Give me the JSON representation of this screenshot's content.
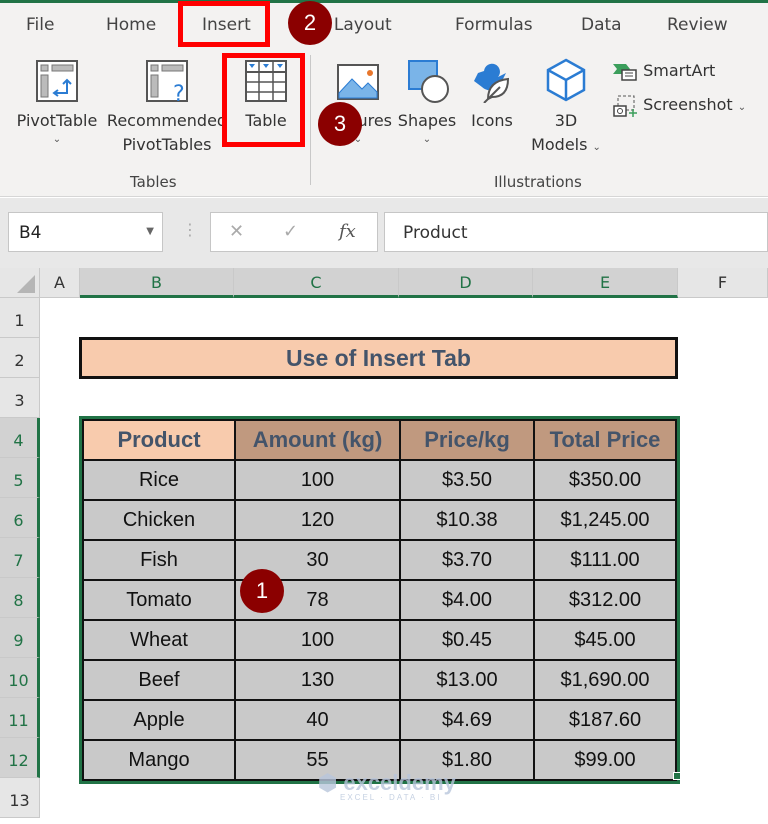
{
  "menu": {
    "tabs": [
      "File",
      "Home",
      "Insert",
      "Page Layout",
      "Formulas",
      "Data",
      "Review"
    ],
    "visible_page_layout": "e Layout"
  },
  "ribbon": {
    "tables_group": {
      "label": "Tables",
      "pivottable": "PivotTable",
      "recommended_line1": "Recommended",
      "recommended_line2": "PivotTables",
      "table": "Table"
    },
    "illustrations_group": {
      "label": "Illustrations",
      "pictures": "ures",
      "shapes": "Shapes",
      "icons": "Icons",
      "models_line1": "3D",
      "models_line2": "Models",
      "smartart": "SmartArt",
      "screenshot": "Screenshot"
    }
  },
  "annotations": {
    "badge1": "1",
    "badge2": "2",
    "badge3": "3"
  },
  "formula_bar": {
    "name_box": "B4",
    "formula": "Product",
    "cancel_icon": "✕",
    "enter_icon": "✓",
    "fx_icon": "fx"
  },
  "grid": {
    "columns": [
      "A",
      "B",
      "C",
      "D",
      "E",
      "F"
    ],
    "rows": [
      "1",
      "2",
      "3",
      "4",
      "5",
      "6",
      "7",
      "8",
      "9",
      "10",
      "11",
      "12",
      "13"
    ]
  },
  "sheet": {
    "title": "Use of Insert Tab",
    "headers": [
      "Product",
      "Amount (kg)",
      "Price/kg",
      "Total Price"
    ],
    "rows": [
      [
        "Rice",
        "100",
        "$3.50",
        "$350.00"
      ],
      [
        "Chicken",
        "120",
        "$10.38",
        "$1,245.00"
      ],
      [
        "Fish",
        "30",
        "$3.70",
        "$111.00"
      ],
      [
        "Tomato",
        "78",
        "$4.00",
        "$312.00"
      ],
      [
        "Wheat",
        "100",
        "$0.45",
        "$45.00"
      ],
      [
        "Beef",
        "130",
        "$13.00",
        "$1,690.00"
      ],
      [
        "Apple",
        "40",
        "$4.69",
        "$187.60"
      ],
      [
        "Mango",
        "55",
        "$1.80",
        "$99.00"
      ]
    ]
  },
  "watermark": {
    "name": "exceldemy",
    "tagline": "EXCEL · DATA · BI"
  },
  "colors": {
    "excel_green": "#217346",
    "highlight_red": "#ff0000",
    "badge_dark_red": "#8b0000",
    "title_fill": "#f8cbad",
    "header_fill": "#c0997f",
    "cell_fill": "#c9c9c9"
  }
}
